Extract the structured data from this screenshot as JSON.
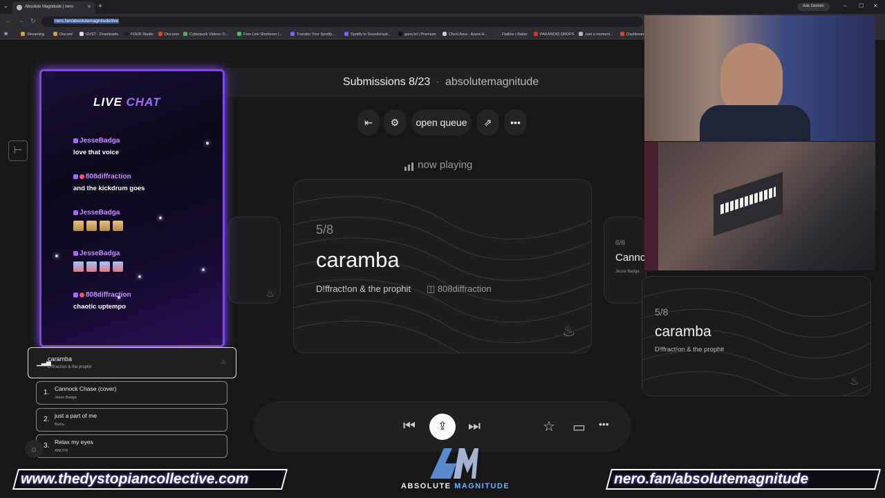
{
  "browser": {
    "tab_title": "Absolute Magnitude | nero",
    "url": "nero.fan/absolutemagnitude/live",
    "gemini_label": "Ask Gemini",
    "bookmarks": [
      "Streaming",
      "Discord",
      "GVST - Downloads",
      "FOUR Studio",
      "Discover",
      "Cyberpunk Videos: D...",
      "Free Link Shortener |...",
      "Transfer Your Spotify...",
      "Spotify to Soundcloud...",
      "guns.lol | Premium",
      "Client Area - Asura H...",
      "Flatline | Baton",
      "PARANOID DROPS",
      "Just a moment...",
      "Dashboard"
    ]
  },
  "header": {
    "submissions": "Submissions 8/23",
    "separator": "·",
    "username": "absolutemagnitude"
  },
  "controls": {
    "open_queue": "open queue",
    "now_playing": "now playing"
  },
  "now_playing_card": {
    "position": "5/8",
    "title": "caramba",
    "artist": "D!ffract!on & the prophit",
    "handle": "808diffraction"
  },
  "next_card": {
    "position": "6/8",
    "title": "Cannc",
    "artist": "Jesse Badga"
  },
  "popup_card": {
    "position": "5/8",
    "title": "caramba",
    "artist": "D!ffract!on & the prophit"
  },
  "live_chat": {
    "title_a": "LIVE",
    "title_b": "CHAT",
    "messages": [
      {
        "user": "JesseBadga",
        "text": "love that voice"
      },
      {
        "user": "808diffraction",
        "text": "and the kickdrum goes"
      },
      {
        "user": "JesseBadga",
        "text": ""
      },
      {
        "user": "JesseBadga",
        "text": ""
      },
      {
        "user": "808diffraction",
        "text": "chaotic uptempo"
      }
    ]
  },
  "queue": {
    "current": {
      "title": "caramba",
      "artist": "D!ffract!on & the prophit"
    },
    "items": [
      {
        "num": "1.",
        "title": "Cannock Chase (cover)",
        "artist": "Jesse Badga"
      },
      {
        "num": "2.",
        "title": "just a part of me",
        "artist": "Bishu"
      },
      {
        "num": "3.",
        "title": "Relax my eyes",
        "artist": "ANOTR"
      }
    ]
  },
  "overlay": {
    "left_banner": "www.thedystopiancollective.com",
    "right_banner": "nero.fan/absolutemagnitude",
    "logo_a": "ABSOLUTE",
    "logo_b": "MAGNITUDE"
  }
}
